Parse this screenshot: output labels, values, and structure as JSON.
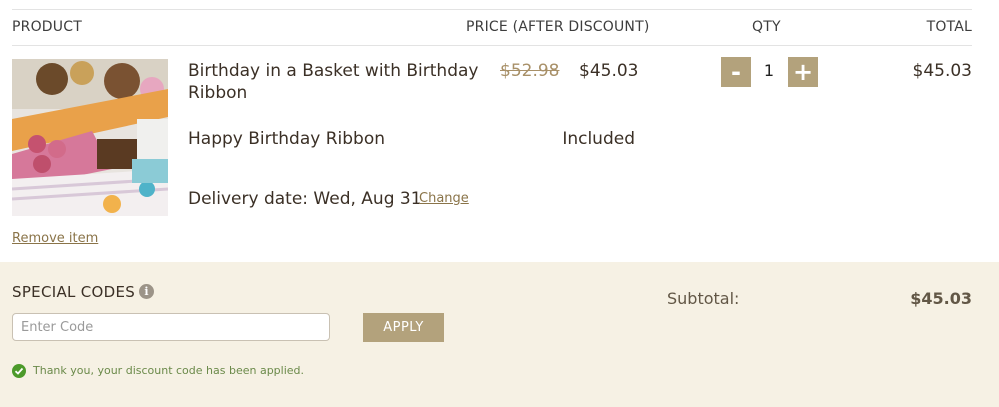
{
  "table": {
    "headers": {
      "product": "PRODUCT",
      "price": "PRICE (AFTER DISCOUNT)",
      "qty": "QTY",
      "total": "TOTAL"
    }
  },
  "item": {
    "name": "Birthday in a Basket with Birthday Ribbon",
    "original_price": "$52.98",
    "price": "$45.03",
    "qty": "1",
    "total": "$45.03",
    "remove_label": "Remove item",
    "minus_label": "-",
    "plus_label": "+",
    "addon_name": "Happy Birthday Ribbon",
    "addon_status": "Included",
    "delivery_label": "Delivery date: Wed, Aug 31",
    "change_label": "Change",
    "image_icon": "product-photo"
  },
  "special_codes": {
    "title": "SPECIAL CODES",
    "info_icon": "info-icon",
    "info_glyph": "i",
    "placeholder": "Enter Code",
    "value": "",
    "apply_label": "APPLY",
    "success_message": "Thank you, your discount code has been applied."
  },
  "summary": {
    "subtotal_label": "Subtotal:",
    "subtotal_value": "$45.03"
  },
  "colors": {
    "accent": "#b3a27c",
    "link": "#8a7449",
    "panel_bg": "#f6f1e4",
    "success": "#4c9a2a",
    "strike_price": "#a89068"
  }
}
